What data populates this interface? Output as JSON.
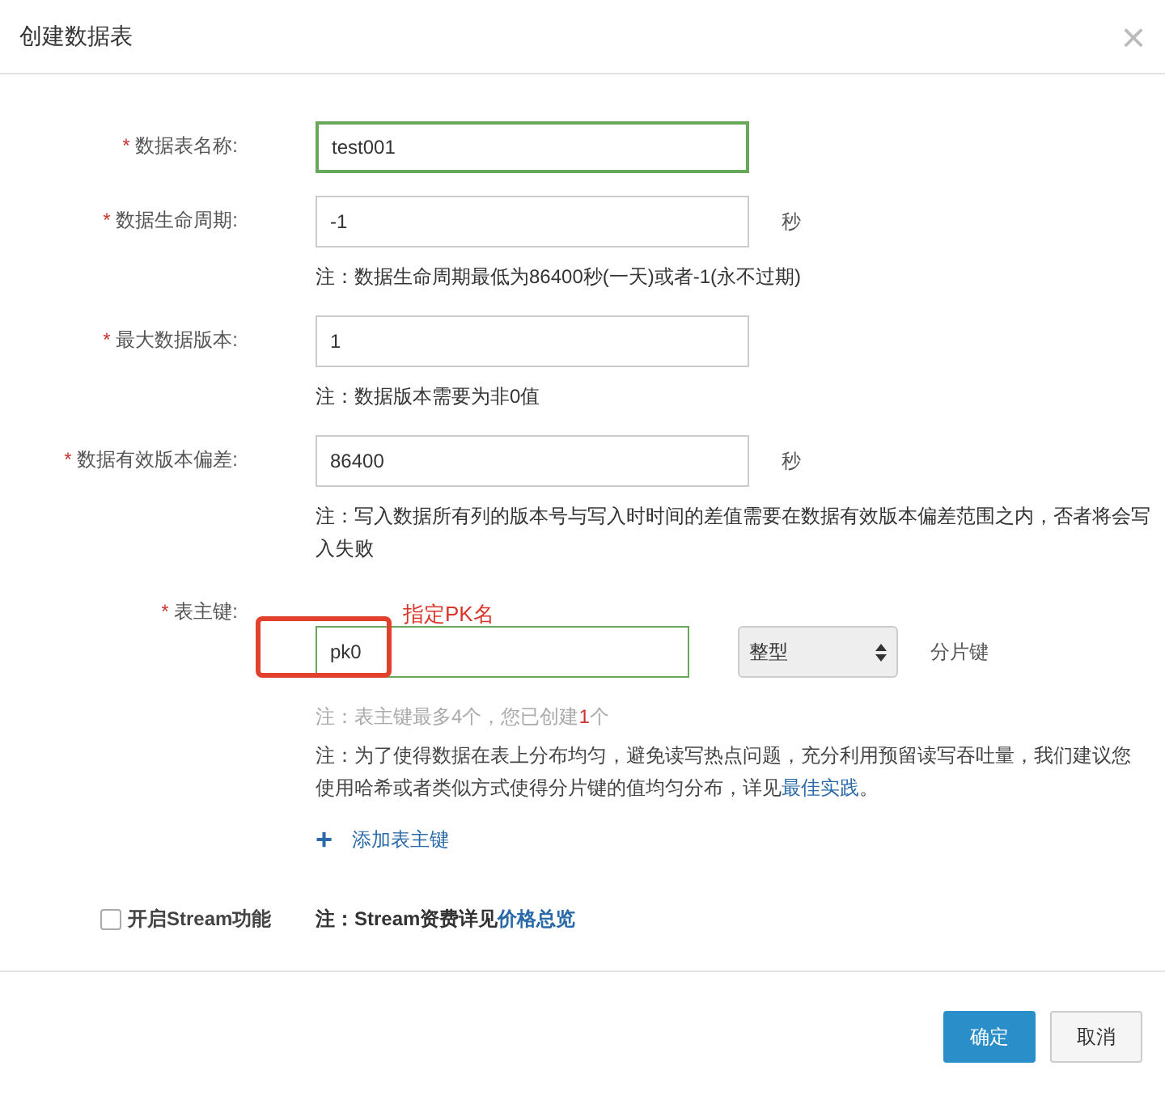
{
  "dialog": {
    "title": "创建数据表",
    "close": "×"
  },
  "fields": [
    {
      "label": "数据表名称:",
      "required_mark": "*",
      "value": "test001",
      "focused": true
    },
    {
      "label": "数据生命周期:",
      "required_mark": "*",
      "value": "-1",
      "focused": false,
      "unit": "秒",
      "note": [
        "注：数据生命周期最低为86400秒(一天)或者-1(永不过期)"
      ]
    },
    {
      "label": "最大数据版本:",
      "required_mark": "*",
      "value": "1",
      "focused": false,
      "note": [
        "注：数据版本需要为非0值"
      ]
    },
    {
      "label": "数据有效版本偏差:",
      "required_mark": "*",
      "value": "86400",
      "focused": false,
      "unit": "秒",
      "note": [
        "注：写入数据所有列的版本号与写入时时间的差值需要在数据有效版本偏差范围之内，否者将会写",
        "入失败"
      ]
    }
  ],
  "primary_key": {
    "label": "表主键:",
    "required_mark": "*",
    "annotation": "指定PK名",
    "value": "pk0",
    "focused": true,
    "type": "整型",
    "shard_label": "分片键",
    "limit_note": {
      "before": "注：表主键最多4个，您已创建",
      "count": "1",
      "after": "个"
    },
    "distribution_note": {
      "line1": "注：为了使得数据在表上分布均匀，避免读写热点问题，充分利用预留读写吞吐量，我们建议您",
      "line2": "使用哈希或者类似方式使得分片键的值均匀分布，详见",
      "link": "最佳实践",
      "end": "。"
    },
    "add_icon": "+",
    "add_label": "添加表主键"
  },
  "stream": {
    "checked": false,
    "label": "开启Stream功能",
    "note": "注：Stream资费详见",
    "link": "价格总览"
  },
  "buttons": [
    {
      "label": "确定",
      "primary": true
    },
    {
      "label": "取消",
      "primary": false
    }
  ]
}
